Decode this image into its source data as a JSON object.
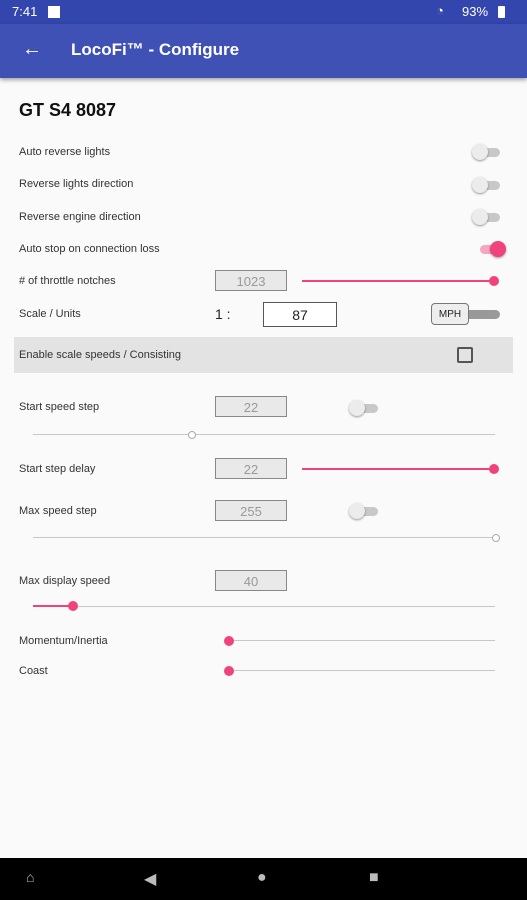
{
  "status": {
    "time": "7:41",
    "battery": "93%"
  },
  "appbar": {
    "title": "LocoFi™ - Configure"
  },
  "device_name": "GT S4 8087",
  "toggles": {
    "auto_reverse_lights": {
      "label": "Auto reverse lights",
      "on": false
    },
    "reverse_lights_direction": {
      "label": "Reverse lights direction",
      "on": false
    },
    "reverse_engine_direction": {
      "label": "Reverse engine direction",
      "on": false
    },
    "auto_stop": {
      "label": "Auto stop on connection loss",
      "on": true
    }
  },
  "throttle": {
    "label": "# of throttle notches",
    "value": "1023"
  },
  "scale": {
    "label": "Scale / Units",
    "prefix": "1 :",
    "value": "87",
    "units": "MPH"
  },
  "scale_speeds": {
    "label": "Enable scale speeds / Consisting",
    "checked": false
  },
  "start_speed_step": {
    "label": "Start speed step",
    "value": "22"
  },
  "start_step_delay": {
    "label": "Start step delay",
    "value": "22"
  },
  "max_speed_step": {
    "label": "Max speed step",
    "value": "255"
  },
  "max_display_speed": {
    "label": "Max display speed",
    "value": "40"
  },
  "momentum": {
    "label": "Momentum/Inertia"
  },
  "coast": {
    "label": "Coast"
  }
}
